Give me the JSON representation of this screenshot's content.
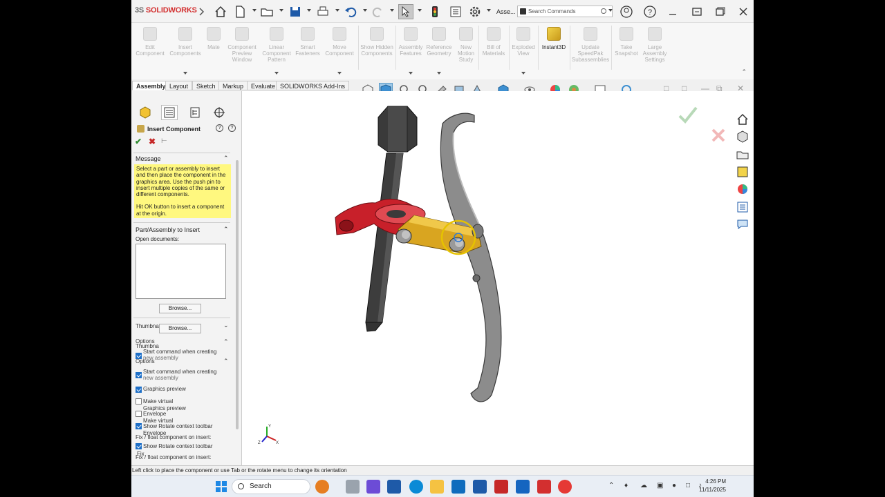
{
  "title_bar": {
    "logo_prefix": "3S",
    "logo_text": "SOLIDWORKS",
    "doc_name": "Asse...",
    "search_placeholder": "Search Commands"
  },
  "ribbon": {
    "buttons": [
      {
        "label": "Edit Component",
        "active": false
      },
      {
        "label": "Insert Components",
        "active": false
      },
      {
        "label": "Mate",
        "active": false
      },
      {
        "label": "Component Preview Window",
        "active": false
      },
      {
        "label": "Linear Component Pattern",
        "active": false
      },
      {
        "label": "Smart Fasteners",
        "active": false
      },
      {
        "label": "Move Component",
        "active": false
      },
      {
        "label": "Show Hidden Components",
        "active": false
      },
      {
        "label": "Assembly Features",
        "active": false
      },
      {
        "label": "Reference Geometry",
        "active": false
      },
      {
        "label": "New Motion Study",
        "active": false
      },
      {
        "label": "Bill of Materials",
        "active": false
      },
      {
        "label": "Exploded View",
        "active": false
      },
      {
        "label": "Instant3D",
        "active": true
      },
      {
        "label": "Update SpeedPak Subassemblies",
        "active": false
      },
      {
        "label": "Take Snapshot",
        "active": false
      },
      {
        "label": "Large Assembly Settings",
        "active": false
      }
    ]
  },
  "tabs": [
    "Assembly",
    "Layout",
    "Sketch",
    "Markup",
    "Evaluate",
    "SOLIDWORKS Add-Ins"
  ],
  "property_manager": {
    "title": "Insert Component",
    "help": "?",
    "message_header": "Message",
    "message_p1": "Select a part or assembly to insert and then place the component in the graphics area. Use the push pin to insert multiple copies of the same or different components.",
    "message_p2": "Hit OK button to insert a component at the origin.",
    "part_header": "Part/Assembly to Insert",
    "open_docs_label": "Open documents:",
    "browse_label": "Browse...",
    "thumbnail_label": "Thumbna",
    "options_label": "Options",
    "opt_start_command": "Start command when creating",
    "opt_new_assembly": "new assembly",
    "opt_graphics_preview": "Graphics preview",
    "opt_make_virtual": "Make virtual",
    "opt_envelope": "Envelope",
    "opt_show_rotate": "Show Rotate context toolbar",
    "opt_fix_float": "Fix / float component on insert:",
    "opt_fix": "Fix"
  },
  "status_bar": {
    "text": "Left click to place the component or use Tab or the rotate menu to change its orientation"
  },
  "taskbar": {
    "search_label": "Search",
    "time": "4:26 PM",
    "date": "11/11/2025"
  },
  "colors": {
    "brand": "#d32f2f",
    "message_bg": "#fff87f",
    "clamp_red": "#c8202a",
    "link_gold": "#d9a520",
    "bolt_dark": "#3a3a3a",
    "jaw_gray": "#8a8a8a"
  }
}
